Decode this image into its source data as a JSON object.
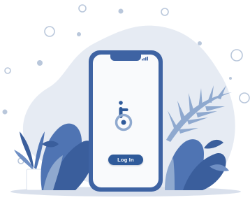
{
  "illustration": {
    "phone": {
      "login_button_label": "Log In"
    }
  },
  "colors": {
    "blob": "#e6ebf3",
    "phone_body": "#3e63a3",
    "phone_screen": "#f9fafc",
    "accent": "#2f5a9a",
    "plant_dark": "#3a5e9c",
    "plant_light": "#8fa9cf",
    "ground": "#d9e0ec"
  }
}
